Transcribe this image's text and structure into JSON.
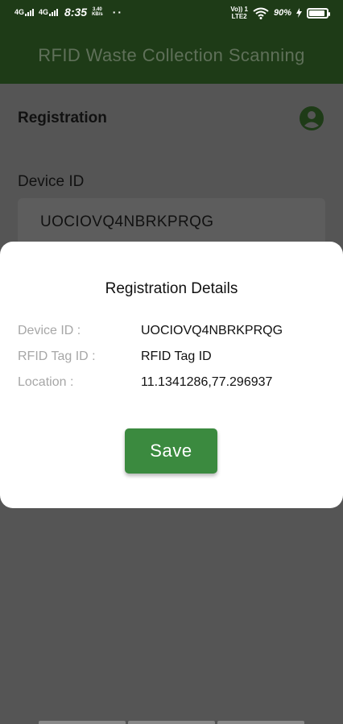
{
  "status_bar": {
    "network1": "4G",
    "network2": "4G",
    "time": "8:35",
    "speed_value": "3.40",
    "speed_unit": "KB/s",
    "extra": "··",
    "volte_top": "Vo)) 1",
    "volte_bottom": "LTE2",
    "battery": "90%",
    "battery_level": 0.9
  },
  "app_bar": {
    "title": "RFID Waste Collection Scanning"
  },
  "page": {
    "heading": "Registration",
    "device_label": "Device ID",
    "device_value": "UOCIOVQ4NBRKPRQG"
  },
  "dialog": {
    "title": "Registration Details",
    "rows": [
      {
        "label": "Device ID :",
        "value": "UOCIOVQ4NBRKPRQG"
      },
      {
        "label": "RFID Tag ID :",
        "value": "RFID Tag ID"
      },
      {
        "label": "Location :",
        "value": "11.1341286,77.296937"
      }
    ],
    "save_label": "Save"
  },
  "colors": {
    "app_bar": "#1e3b17",
    "scrim": "#555555",
    "save_button": "#3b8a3f",
    "profile_icon": "#1e3b17"
  }
}
